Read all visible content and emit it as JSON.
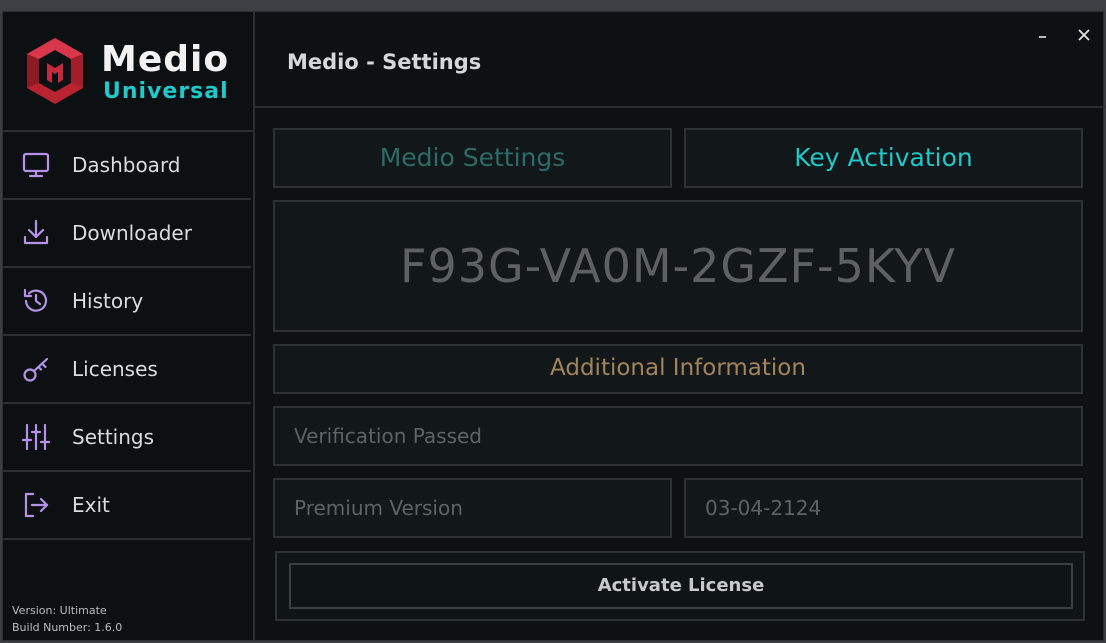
{
  "app": {
    "logo_title": "Medio",
    "logo_subtitle": "Universal",
    "window_title": "Medio - Settings",
    "minimize_icon": "minimize-icon",
    "close_icon": "close-icon"
  },
  "sidebar": {
    "items": [
      {
        "label": "Dashboard",
        "icon": "monitor-icon"
      },
      {
        "label": "Downloader",
        "icon": "download-icon"
      },
      {
        "label": "History",
        "icon": "history-icon"
      },
      {
        "label": "Licenses",
        "icon": "key-icon"
      },
      {
        "label": "Settings",
        "icon": "sliders-icon"
      },
      {
        "label": "Exit",
        "icon": "exit-icon"
      }
    ],
    "version_line": "Version: Ultimate",
    "build_line": "Build Number: 1.6.0"
  },
  "tabs": [
    {
      "label": "Medio Settings",
      "active": false
    },
    {
      "label": "Key Activation",
      "active": true
    }
  ],
  "license": {
    "key": "F93G-VA0M-2GZF-5KYV",
    "additional_info_label": "Additional Information",
    "verification_status": "Verification Passed",
    "edition": "Premium Version",
    "expiry_date": "03-04-2124",
    "activate_label": "Activate License"
  },
  "colors": {
    "accent_teal": "#22c7c7",
    "tab_inactive": "#2d6b67",
    "nav_icon": "#b592e8",
    "logo_red": "#c42a3c",
    "info_gold": "#a2835b"
  }
}
